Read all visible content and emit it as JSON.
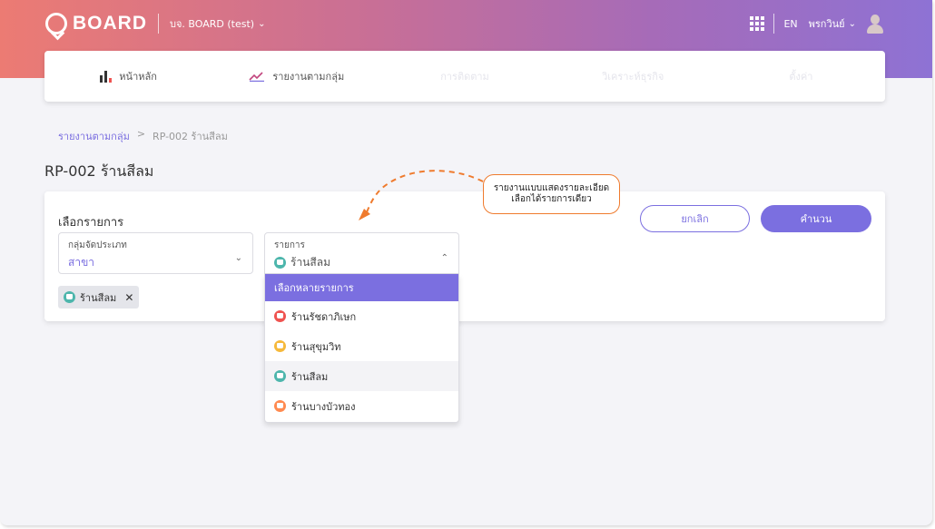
{
  "header": {
    "logo_text": "BOARD",
    "company": "บจ. BOARD (test)",
    "language": "EN",
    "user_name": "พรกวินย์"
  },
  "nav": {
    "items": [
      {
        "label": "หน้าหลัก"
      },
      {
        "label": "รายงานตามกลุ่ม"
      },
      {
        "label": "การติดตาม"
      },
      {
        "label": "วิเคราะห์ธุรกิจ"
      },
      {
        "label": "ตั้งค่า"
      }
    ]
  },
  "breadcrumb": {
    "link": "รายงานตามกลุ่ม",
    "separator": ">",
    "current": "RP-002 ร้านสีลม"
  },
  "page": {
    "title": "RP-002 ร้านสีลม"
  },
  "form": {
    "section_label": "เลือกรายการ",
    "group_field": {
      "label": "กลุ่มจัดประเภท",
      "value": "สาขา"
    },
    "item_field": {
      "label": "รายการ",
      "value": "ร้านสีลม"
    },
    "chip": {
      "label": "ร้านสีลม",
      "remove": "✕"
    },
    "cancel_label": "ยกเลิก",
    "calc_label": "คำนวน"
  },
  "dropdown": {
    "header": "เลือกหลายรายการ",
    "options": [
      {
        "label": "ร้านรัชดาภิเษก",
        "color": "#ef5350"
      },
      {
        "label": "ร้านสุขุมวิท",
        "color": "#f6b93b"
      },
      {
        "label": "ร้านสีลม",
        "color": "#4db6ac",
        "selected": true
      },
      {
        "label": "ร้านบางบัวทอง",
        "color": "#ff8a50"
      }
    ]
  },
  "callout": {
    "line1": "รายงานแบบแสดงรายละเอียด",
    "line2": "เลือกได้รายการเดียว"
  },
  "colors": {
    "accent": "#7b6fe0",
    "callout_border": "#ef7b2e",
    "selected_shop": "#4db6ac"
  }
}
